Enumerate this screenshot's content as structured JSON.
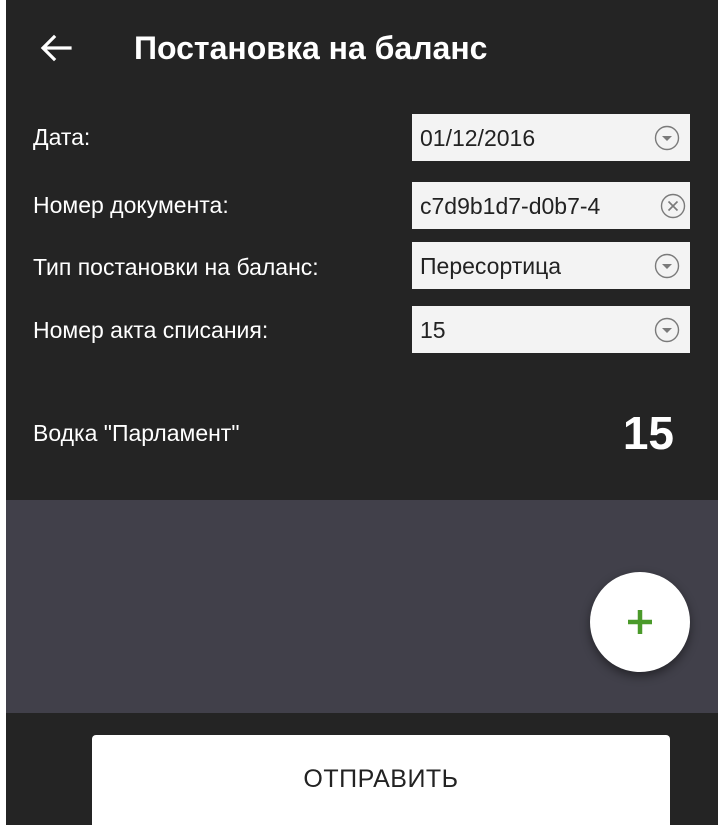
{
  "header": {
    "title": "Постановка на баланс",
    "back_icon": "arrow-left-icon"
  },
  "form": {
    "date_label": "Дата:",
    "date_value": "01/12/2016",
    "doc_number_label": "Номер документа:",
    "doc_number_value": "c7d9b1d7-d0b7-4",
    "type_label": "Тип постановки на баланс:",
    "type_value": "Пересортица",
    "act_label": "Номер акта списания:",
    "act_value": "15"
  },
  "item": {
    "name": "Водка \"Парламент\"",
    "quantity": "15"
  },
  "fab": {
    "icon": "plus-icon",
    "color": "#4a9a2a"
  },
  "footer": {
    "send_label": "ОТПРАВИТЬ"
  },
  "colors": {
    "background": "#242424",
    "list_area": "#41404a",
    "field": "#f3f3f3"
  }
}
